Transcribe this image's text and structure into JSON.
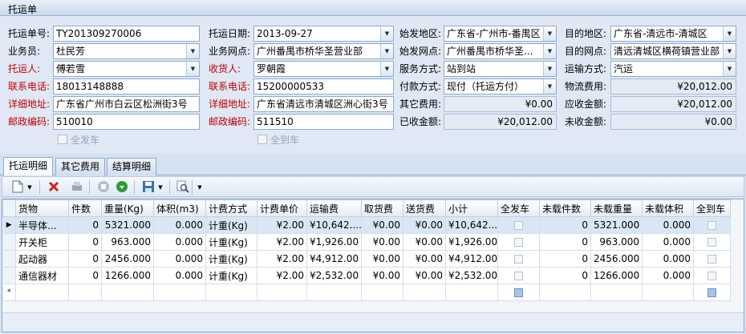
{
  "title": "托运单",
  "form": {
    "waybill_no": {
      "label": "托运单号:",
      "value": "TY201309270006"
    },
    "ship_date": {
      "label": "托运日期:",
      "value": "2013-09-27"
    },
    "origin": {
      "label": "始发地区:",
      "value": "广东省-广州市-番禺区"
    },
    "dest": {
      "label": "目的地区:",
      "value": "广东省-清远市-清城区"
    },
    "salesman": {
      "label": "业务员:",
      "value": "杜民芳"
    },
    "branch": {
      "label": "业务网点:",
      "value": "广州番禺市桥华圣营业部"
    },
    "origin_outlet": {
      "label": "始发网点:",
      "value": "广州番禺市桥华圣..."
    },
    "dest_outlet": {
      "label": "目的网点:",
      "value": "清远清城区横荷镇营业部"
    },
    "shipper": {
      "label": "托运人:",
      "value": "傅若雪"
    },
    "consignee": {
      "label": "收货人:",
      "value": "罗朝霞"
    },
    "service": {
      "label": "服务方式:",
      "value": "站到站"
    },
    "transport": {
      "label": "运输方式:",
      "value": "汽运"
    },
    "shipper_phone": {
      "label": "联系电话:",
      "value": "18013148888"
    },
    "consignee_phone": {
      "label": "联系电话:",
      "value": "15200000533"
    },
    "payment": {
      "label": "付款方式:",
      "value": "现付（托运方付）"
    },
    "logistics_fee": {
      "label": "物流费用:",
      "value": "¥20,012.00"
    },
    "shipper_addr": {
      "label": "详细地址:",
      "value": "广东省广州市白云区松洲街3号"
    },
    "consignee_addr": {
      "label": "详细地址:",
      "value": "广东省清远市清城区洲心街3号"
    },
    "other_fee": {
      "label": "其它费用:",
      "value": "¥0.00"
    },
    "receivable": {
      "label": "应收金额:",
      "value": "¥20,012.00"
    },
    "shipper_zip": {
      "label": "邮政编码:",
      "value": "510010"
    },
    "consignee_zip": {
      "label": "邮政编码:",
      "value": "511510"
    },
    "received": {
      "label": "已收金额:",
      "value": "¥20,012.00"
    },
    "unreceived": {
      "label": "未收金额:",
      "value": "¥0.00"
    },
    "all_sent": "全发车",
    "all_arrived": "全到车"
  },
  "tabs": [
    "托运明细",
    "其它费用",
    "结算明细"
  ],
  "grid": {
    "columns": [
      "货物",
      "件数",
      "重量(Kg)",
      "体积(m3)",
      "计费方式",
      "计费单价",
      "运输费",
      "取货费",
      "送货费",
      "小计",
      "全发车",
      "未载件数",
      "未载重量",
      "未载体积",
      "全到车"
    ],
    "rows": [
      [
        "半导体...",
        "0",
        "5321.000",
        "0.000",
        "计重(Kg)",
        "¥2.00",
        "¥10,642....",
        "¥0.00",
        "¥0.00",
        "¥10,642....",
        "",
        "0",
        "5321.000",
        "0.000",
        ""
      ],
      [
        "开关柜",
        "0",
        "963.000",
        "0.000",
        "计重(Kg)",
        "¥2.00",
        "¥1,926.00",
        "¥0.00",
        "¥0.00",
        "¥1,926.00",
        "",
        "0",
        "963.000",
        "0.000",
        ""
      ],
      [
        "起动器",
        "0",
        "2456.000",
        "0.000",
        "计重(Kg)",
        "¥2.00",
        "¥4,912.00",
        "¥0.00",
        "¥0.00",
        "¥4,912.00",
        "",
        "0",
        "2456.000",
        "0.000",
        ""
      ],
      [
        "通信器材",
        "0",
        "1266.000",
        "0.000",
        "计重(Kg)",
        "¥2.00",
        "¥2,532.00",
        "¥0.00",
        "¥0.00",
        "¥2,532.00",
        "",
        "0",
        "1266.000",
        "0.000",
        ""
      ]
    ],
    "current_row_marker": "▶",
    "new_row_marker": "*"
  },
  "icons": [
    "new-doc-icon",
    "delete-icon",
    "print-icon",
    "stop-icon",
    "refresh-icon",
    "save-icon",
    "search-icon",
    "more-icon"
  ],
  "colors": {
    "required_label": "#c00000",
    "accent": "#8fa9cf"
  }
}
